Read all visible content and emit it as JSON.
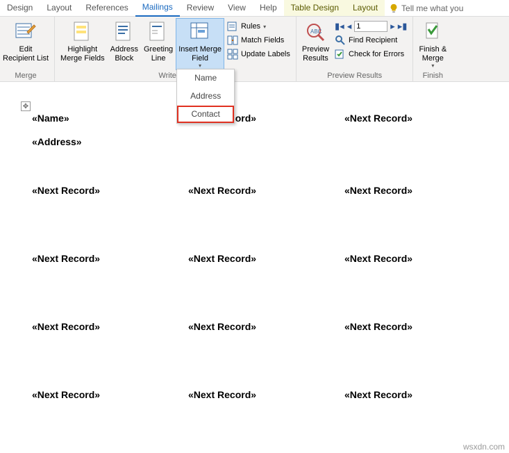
{
  "tabs": {
    "design": "Design",
    "layout": "Layout",
    "references": "References",
    "mailings": "Mailings",
    "review": "Review",
    "view": "View",
    "help": "Help",
    "table_design": "Table Design",
    "tbl_layout": "Layout",
    "tellme": "Tell me what you"
  },
  "ribbon": {
    "edit_recipients": "Edit\nRecipient List",
    "highlight": "Highlight\nMerge Fields",
    "address_block": "Address\nBlock",
    "greeting": "Greeting\nLine",
    "insert_merge": "Insert Merge\nField",
    "rules": "Rules",
    "match_fields": "Match Fields",
    "update_labels": "Update Labels",
    "preview": "Preview\nResults",
    "record_value": "1",
    "find_recipient": "Find Recipient",
    "check_errors": "Check for Errors",
    "finish": "Finish &\nMerge",
    "grp_merge": "Merge",
    "grp_write": "Write & In",
    "grp_preview": "Preview Results",
    "grp_finish": "Finish"
  },
  "dropdown": {
    "name": "Name",
    "address": "Address",
    "contact": "Contact"
  },
  "doc": {
    "name_field": "«Name»",
    "address_field": "«Address»",
    "next_record": "«Next Record»"
  },
  "watermark": "wsxdn.com"
}
